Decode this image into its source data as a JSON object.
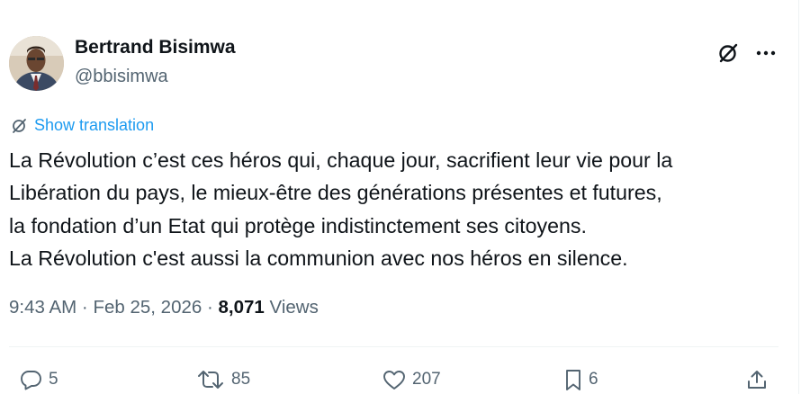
{
  "author": {
    "name": "Bertrand Bisimwa",
    "handle": "@bbisimwa"
  },
  "header_icons": {
    "grok": "grok-icon",
    "more": "more-icon"
  },
  "translation": {
    "label": "Show translation",
    "icon": "translate-icon"
  },
  "tweet": {
    "lines": [
      "La Révolution c’est ces héros qui, chaque jour, sacrifient leur vie pour la",
      "Libération du pays, le mieux-être des générations présentes et futures,",
      "la fondation d’un Etat qui protège indistinctement ses citoyens.",
      "La Révolution c'est aussi la communion avec nos héros en silence."
    ]
  },
  "meta": {
    "time": "9:43 AM",
    "separator": "·",
    "date": "Feb 25, 2026",
    "views_count": "8,071",
    "views_label": "Views"
  },
  "actions": {
    "replies": "5",
    "reposts": "85",
    "likes": "207",
    "bookmarks": "6",
    "share": "share-icon"
  },
  "colors": {
    "text": "#0f1419",
    "secondary": "#536471",
    "link": "#1d9bf0",
    "divider": "#eff3f4"
  }
}
